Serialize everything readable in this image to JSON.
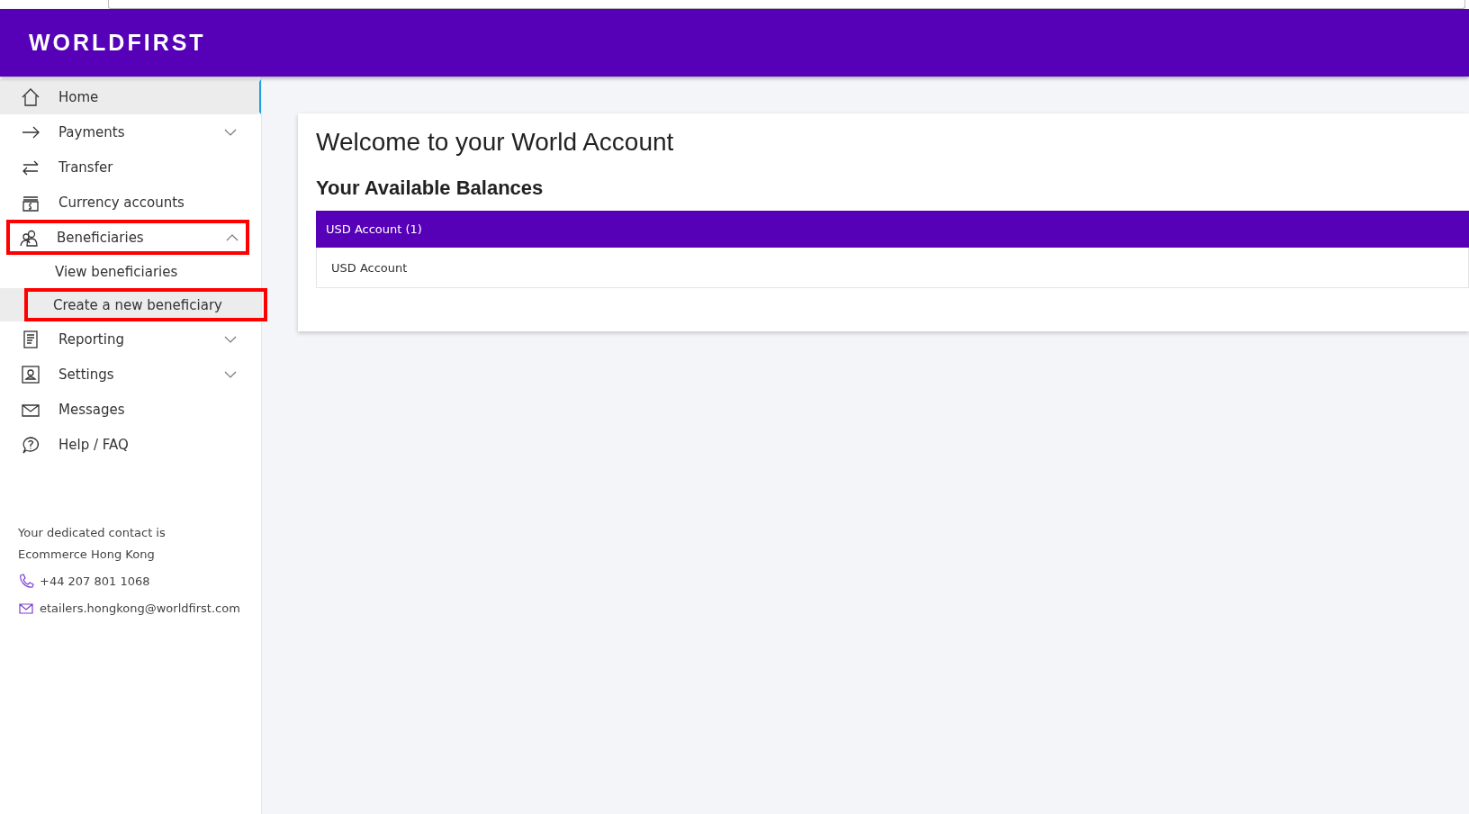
{
  "header": {
    "logo": "WORLDFIRST"
  },
  "sidebar": {
    "items": [
      {
        "kind": "home",
        "label": "Home",
        "selected": true,
        "highlighted": false
      },
      {
        "kind": "arrow",
        "label": "Payments",
        "selected": false,
        "highlighted": false,
        "expanded": false
      },
      {
        "kind": "transfer",
        "label": "Transfer",
        "selected": false,
        "highlighted": false
      },
      {
        "kind": "wallet",
        "label": "Currency accounts",
        "selected": false,
        "highlighted": false
      },
      {
        "kind": "people",
        "label": "Beneficiaries",
        "selected": false,
        "highlighted": true,
        "expanded": true,
        "children": [
          {
            "label": "View beneficiaries",
            "selected": false,
            "highlighted": false
          },
          {
            "label": "Create a new beneficiary",
            "selected": true,
            "highlighted": true
          }
        ]
      },
      {
        "kind": "report",
        "label": "Reporting",
        "selected": false,
        "highlighted": false,
        "expanded": false
      },
      {
        "kind": "profile",
        "label": "Settings",
        "selected": false,
        "highlighted": false,
        "expanded": false
      },
      {
        "kind": "mail",
        "label": "Messages",
        "selected": false,
        "highlighted": false
      },
      {
        "kind": "help",
        "label": "Help / FAQ",
        "selected": false,
        "highlighted": false
      }
    ],
    "contact": {
      "lines": [
        "Your dedicated contact is",
        "Ecommerce Hong Kong"
      ],
      "phone": "+44 207 801 1068",
      "email": "etailers.hongkong@worldfirst.com"
    }
  },
  "main": {
    "title": "Welcome to your World Account",
    "subtitle": "Your Available Balances",
    "accounts": [
      {
        "header": "USD Account (1)",
        "rows": [
          "USD Account"
        ]
      }
    ]
  }
}
